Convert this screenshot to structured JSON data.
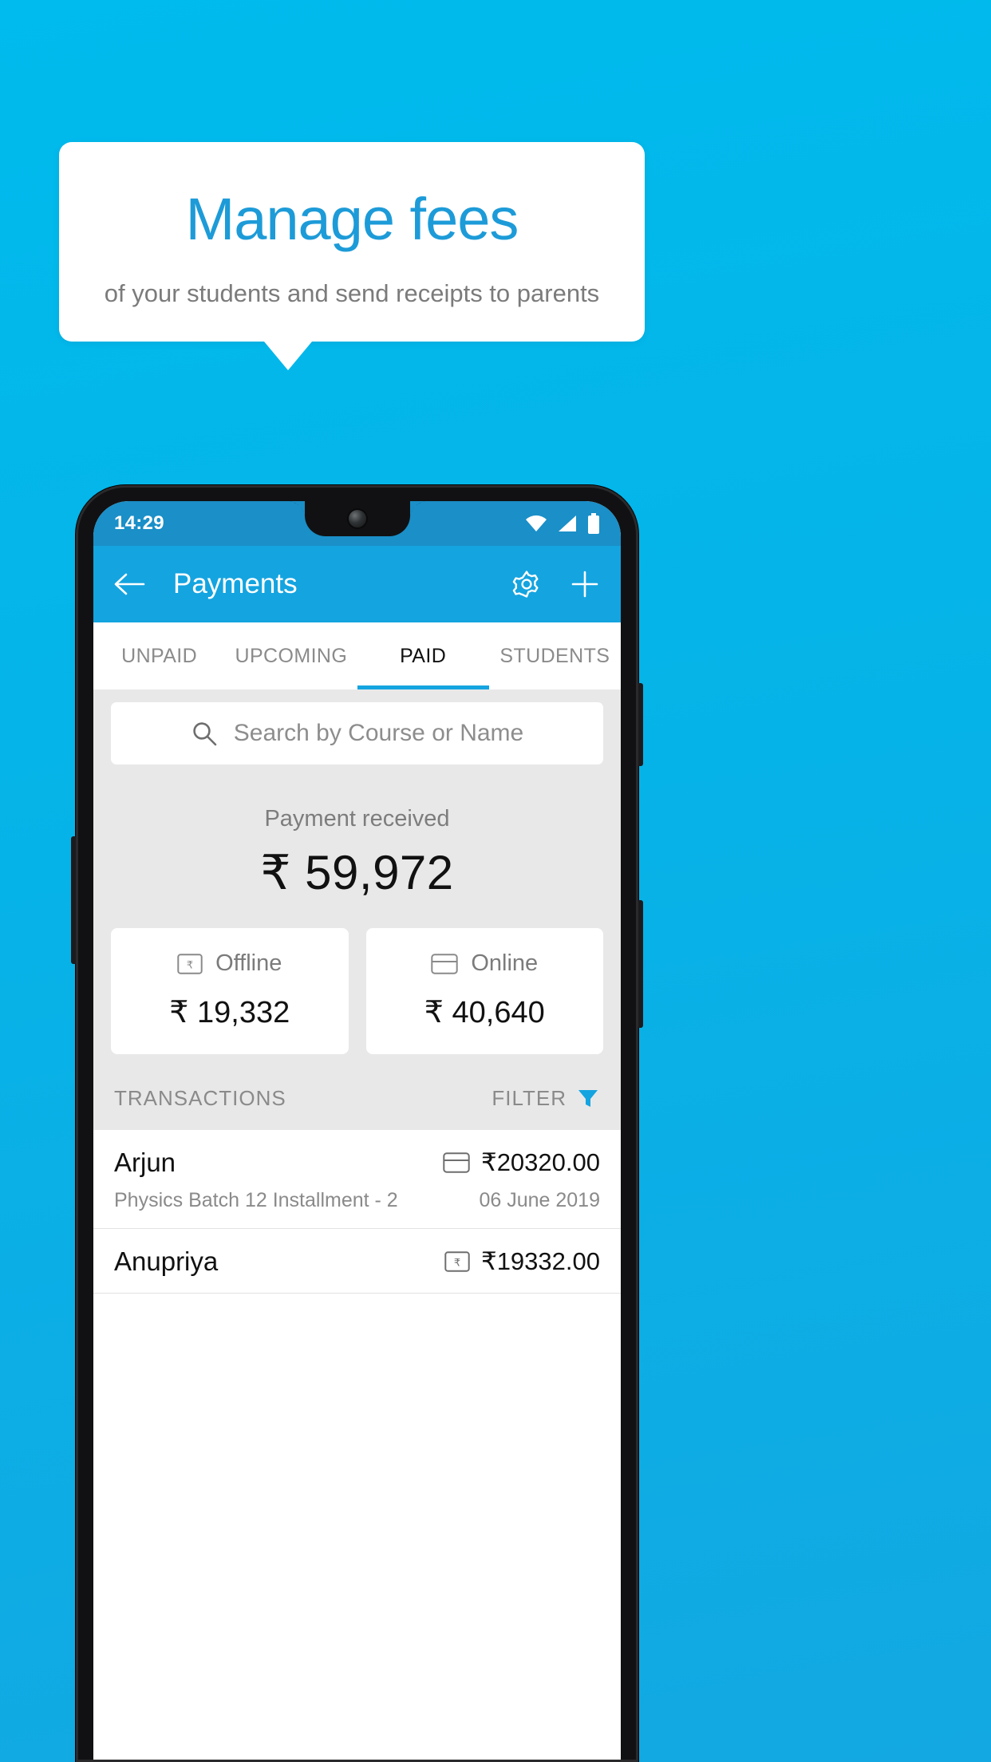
{
  "promo": {
    "title": "Manage fees",
    "subtitle": "of your students and send receipts to parents",
    "title_color": "#1d9bd8",
    "background_color": "#00bbed"
  },
  "phone": {
    "statusbar": {
      "time": "14:29",
      "icons": [
        "wifi-icon",
        "signal-icon",
        "battery-icon"
      ]
    },
    "appbar": {
      "back_icon": "back-arrow-icon",
      "title": "Payments",
      "settings_icon": "gear-icon",
      "add_icon": "plus-icon",
      "color": "#14a4e0"
    },
    "tabs": [
      {
        "label": "UNPAID",
        "active": false
      },
      {
        "label": "UPCOMING",
        "active": false
      },
      {
        "label": "PAID",
        "active": true
      },
      {
        "label": "STUDENTS",
        "active": false
      }
    ],
    "search": {
      "placeholder": "Search by Course or Name",
      "icon": "search-icon",
      "value": ""
    },
    "summary": {
      "label": "Payment received",
      "amount": "₹ 59,972",
      "breakdown": [
        {
          "label": "Offline",
          "amount": "₹ 19,332",
          "icon": "rupee-note-icon"
        },
        {
          "label": "Online",
          "amount": "₹ 40,640",
          "icon": "credit-card-icon"
        }
      ]
    },
    "transactions_header": {
      "title": "TRANSACTIONS",
      "filter_label": "FILTER",
      "filter_icon": "funnel-icon"
    },
    "transactions": [
      {
        "name": "Arjun",
        "description": "Physics Batch 12 Installment - 2",
        "amount": "₹20320.00",
        "date": "06 June 2019",
        "method_icon": "credit-card-icon"
      },
      {
        "name": "Anupriya",
        "description": "",
        "amount": "₹19332.00",
        "date": "",
        "method_icon": "rupee-note-icon"
      }
    ]
  }
}
